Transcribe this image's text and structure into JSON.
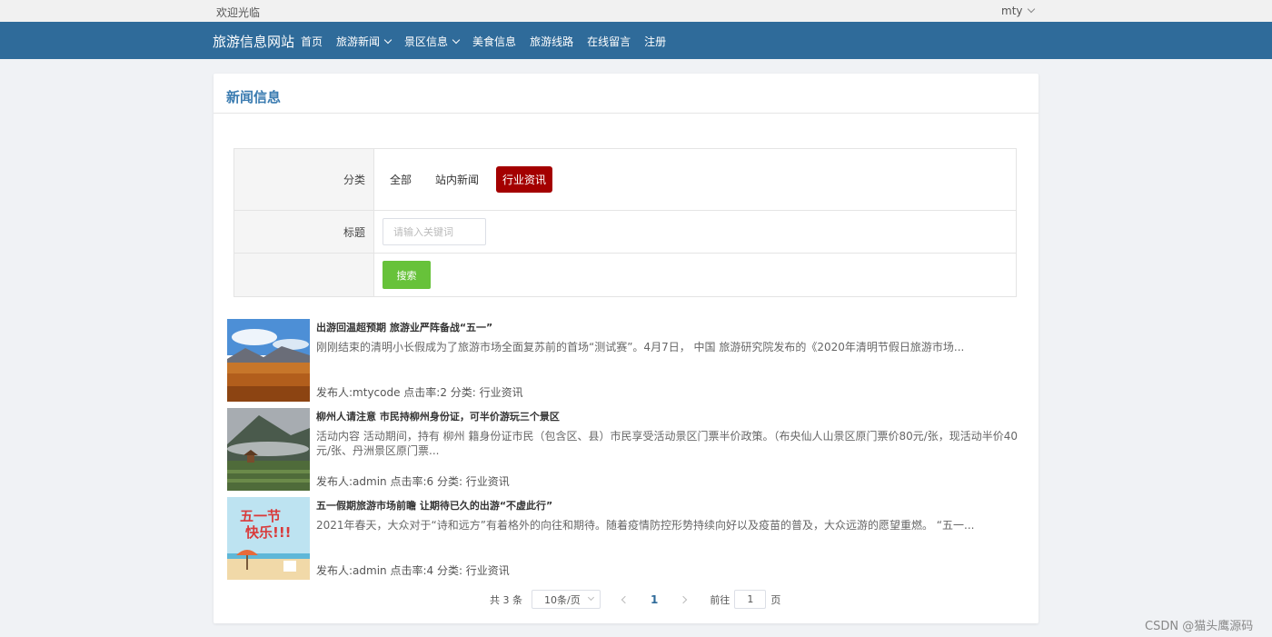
{
  "topbar": {
    "welcome": "欢迎光临",
    "user": "mty"
  },
  "nav": {
    "brand": "旅游信息网站",
    "items": [
      "首页",
      "旅游新闻",
      "景区信息",
      "美食信息",
      "旅游线路",
      "在线留言",
      "注册"
    ]
  },
  "panel": {
    "title": "新闻信息"
  },
  "filter": {
    "category_label": "分类",
    "categories": [
      "全部",
      "站内新闻",
      "行业资讯"
    ],
    "title_label": "标题",
    "title_placeholder": "请输入关键词",
    "search_button": "搜索"
  },
  "news": [
    {
      "title": "出游回温超预期 旅游业严阵备战“五一”",
      "summary": "刚刚结束的清明小长假成为了旅游市场全面复苏前的首场“测试赛”。4月7日， 中国 旅游研究院发布的《2020年清明节假日旅游市场...",
      "meta": "发布人:mtycode  点击率:2  分类: 行业资讯"
    },
    {
      "title": "柳州人请注意 市民持柳州身份证，可半价游玩三个景区",
      "summary": "活动内容 活动期间，持有 柳州 籍身份证市民（包含区、县）市民享受活动景区门票半价政策。（布央仙人山景区原门票价80元/张，现活动半价40元/张、丹洲景区原门票...",
      "meta": "发布人:admin  点击率:6  分类: 行业资讯"
    },
    {
      "title": "五一假期旅游市场前瞻 让期待已久的出游“不虚此行”",
      "summary": "2021年春天，大众对于“诗和远方”有着格外的向往和期待。随着疫情防控形势持续向好以及疫苗的普及，大众远游的愿望重燃。 “五一...",
      "meta": "发布人:admin  点击率:4  分类: 行业资讯"
    }
  ],
  "pagination": {
    "total": "共 3 条",
    "page_size": "10条/页",
    "current": "1",
    "goto_prefix": "前往",
    "goto_value": "1",
    "goto_suffix": "页"
  },
  "watermark": "CSDN @猫头鹰源码",
  "colors": {
    "nav_bg": "#2f6b9a",
    "active_category": "#a40000",
    "search_button": "#67c23a"
  }
}
